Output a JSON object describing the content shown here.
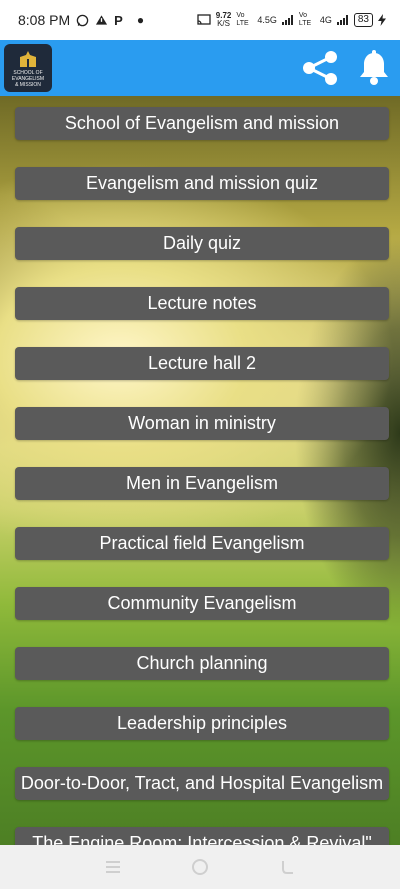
{
  "status_bar": {
    "time": "8:08 PM",
    "icons": [
      "whatsapp-icon",
      "warning-icon",
      "p-icon",
      "dot-icon"
    ],
    "net_speed_value": "9.72",
    "net_speed_unit": "K/S",
    "volte1": "Vo LTE",
    "net1": "4.5G",
    "volte2": "Vo LTE",
    "net2": "4G",
    "battery": "83"
  },
  "app_bar": {
    "logo_text_line1": "SCHOOL OF",
    "logo_text_line2": "EVANGELISM",
    "logo_text_line3": "& MISSION"
  },
  "menu": {
    "items": [
      {
        "label": "School of Evangelism and mission"
      },
      {
        "label": "Evangelism and mission quiz"
      },
      {
        "label": "Daily quiz"
      },
      {
        "label": "Lecture notes"
      },
      {
        "label": "Lecture hall 2"
      },
      {
        "label": "Woman in ministry"
      },
      {
        "label": "Men in Evangelism"
      },
      {
        "label": "Practical field Evangelism"
      },
      {
        "label": "Community Evangelism"
      },
      {
        "label": "Church planning"
      },
      {
        "label": "Leadership principles"
      },
      {
        "label": "Door-to-Door, Tract, and Hospital Evangelism"
      },
      {
        "label": "The Engine Room: Intercession & Revival\""
      }
    ]
  },
  "colors": {
    "app_bar": "#2a9cf0",
    "button_bg": "#5a5a5a",
    "button_text": "#ffffff"
  }
}
